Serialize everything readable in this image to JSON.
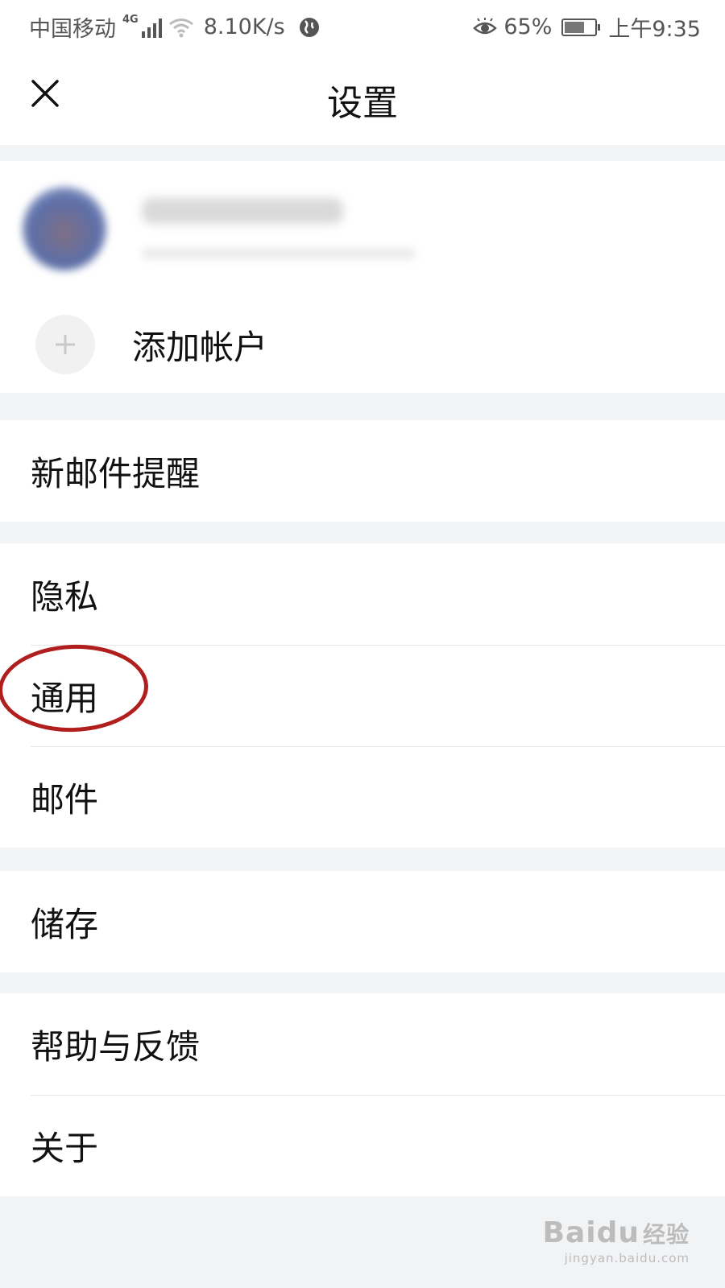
{
  "status_bar": {
    "carrier": "中国移动",
    "network_type": "4G",
    "net_speed": "8.10K/s",
    "battery_percent": "65%",
    "battery_level": 0.65,
    "time": "上午9:35",
    "icons": [
      "signal-icon",
      "wifi-icon",
      "vpn-globe-icon",
      "eye-protection-icon",
      "battery-icon"
    ]
  },
  "nav": {
    "title": "设置",
    "close_icon": "close-icon"
  },
  "account": {
    "add_account_label": "添加帐户"
  },
  "settings": {
    "notifications": "新邮件提醒",
    "privacy": "隐私",
    "general": "通用",
    "mail": "邮件",
    "storage": "储存",
    "help": "帮助与反馈",
    "about": "关于"
  },
  "colors": {
    "annotation": "#b01e1e",
    "section_gap": "#f2f3f5"
  },
  "watermark": {
    "brand": "Baidu",
    "brand_cn": "经验",
    "domain": "jingyan.baidu.com"
  }
}
